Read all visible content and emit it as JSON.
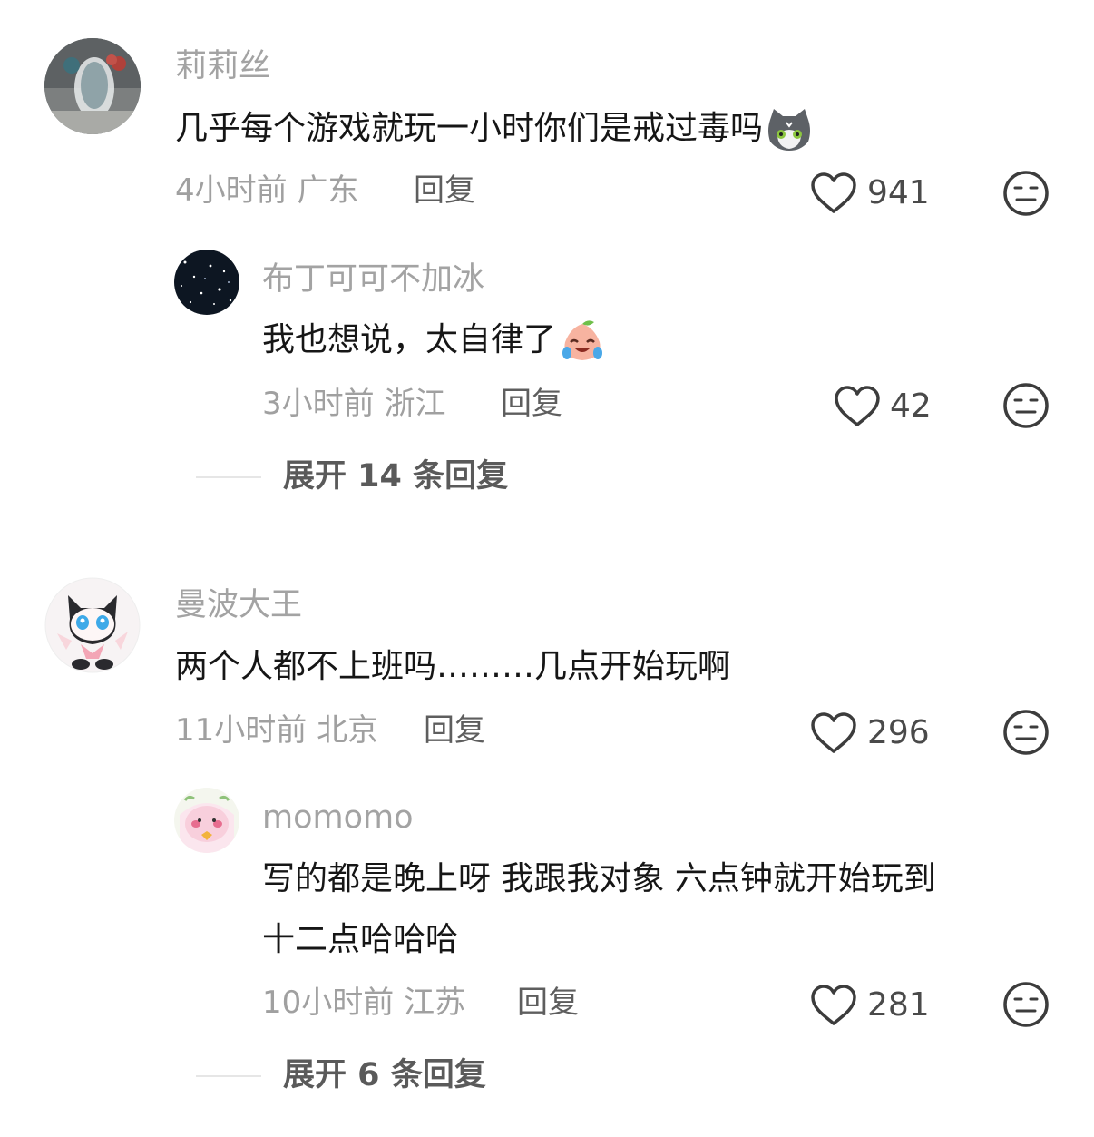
{
  "comments": [
    {
      "username": "莉莉丝",
      "content": "几乎每个游戏就玩一小时你们是戒过毒吗",
      "emoji": "cat-face-emoji",
      "time": "4小时前",
      "location": "广东",
      "reply_label": "回复",
      "likes": "941",
      "sub_reply": {
        "username": "布丁可可不加冰",
        "content": "我也想说，太自律了",
        "emoji": "crying-laughing-peach-emoji",
        "time": "3小时前",
        "location": "浙江",
        "reply_label": "回复",
        "likes": "42"
      },
      "expand_label": "展开 14 条回复"
    },
    {
      "username": "曼波大王",
      "content": "两个人都不上班吗………几点开始玩啊",
      "time": "11小时前",
      "location": "北京",
      "reply_label": "回复",
      "likes": "296",
      "sub_reply": {
        "username": "momomo",
        "content_line1": "写的都是晚上呀 我跟我对象 六点钟就开始玩到",
        "content_line2": "十二点哈哈哈",
        "time": "10小时前",
        "location": "江苏",
        "reply_label": "回复",
        "likes": "281"
      },
      "expand_label": "展开 6 条回复"
    }
  ],
  "colors": {
    "username": "#a3a3a3",
    "text": "#161616",
    "meta": "#a0a0a0",
    "icon": "#3c3c3c"
  }
}
